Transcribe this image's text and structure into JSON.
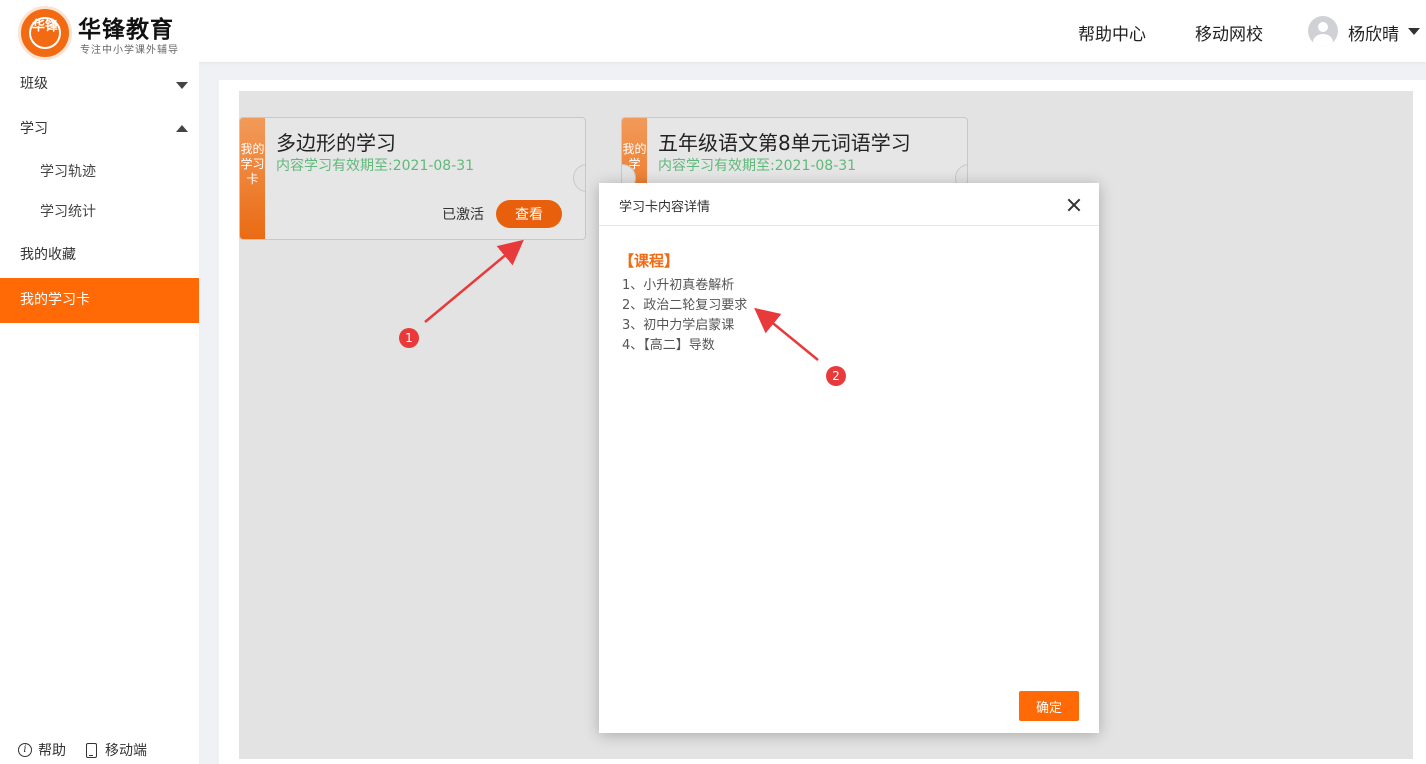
{
  "header": {
    "logo_text": "华锋",
    "brand": "华锋教育",
    "slogan": "专注中小学课外辅导",
    "nav": [
      "帮助中心",
      "移动网校"
    ],
    "username": "杨欣晴"
  },
  "sidebar": {
    "items": [
      {
        "label": "班级",
        "expanded": false
      },
      {
        "label": "学习",
        "expanded": true
      },
      {
        "label": "学习轨迹"
      },
      {
        "label": "学习统计"
      },
      {
        "label": "我的收藏"
      },
      {
        "label": "我的学习卡",
        "active": true
      }
    ],
    "footer": {
      "help": "帮助",
      "mobile": "移动端"
    }
  },
  "cards": [
    {
      "tab": "我的学习卡",
      "title": "多边形的学习",
      "valid": "内容学习有效期至:2021-08-31",
      "status": "已激活",
      "button": "查看"
    },
    {
      "tab": "我的学",
      "title": "五年级语文第8单元词语学习",
      "valid": "内容学习有效期至:2021-08-31"
    }
  ],
  "modal": {
    "title": "学习卡内容详情",
    "section": "【课程】",
    "courses": [
      "1、小升初真卷解析",
      "2、政治二轮复习要求",
      "3、初中力学启蒙课",
      "4、【高二】导数"
    ],
    "confirm": "确定"
  },
  "annotations": [
    "1",
    "2"
  ],
  "colors": {
    "accent": "#ff6a07",
    "valid_text": "#5fb97a",
    "badge": "#e83a3a"
  }
}
